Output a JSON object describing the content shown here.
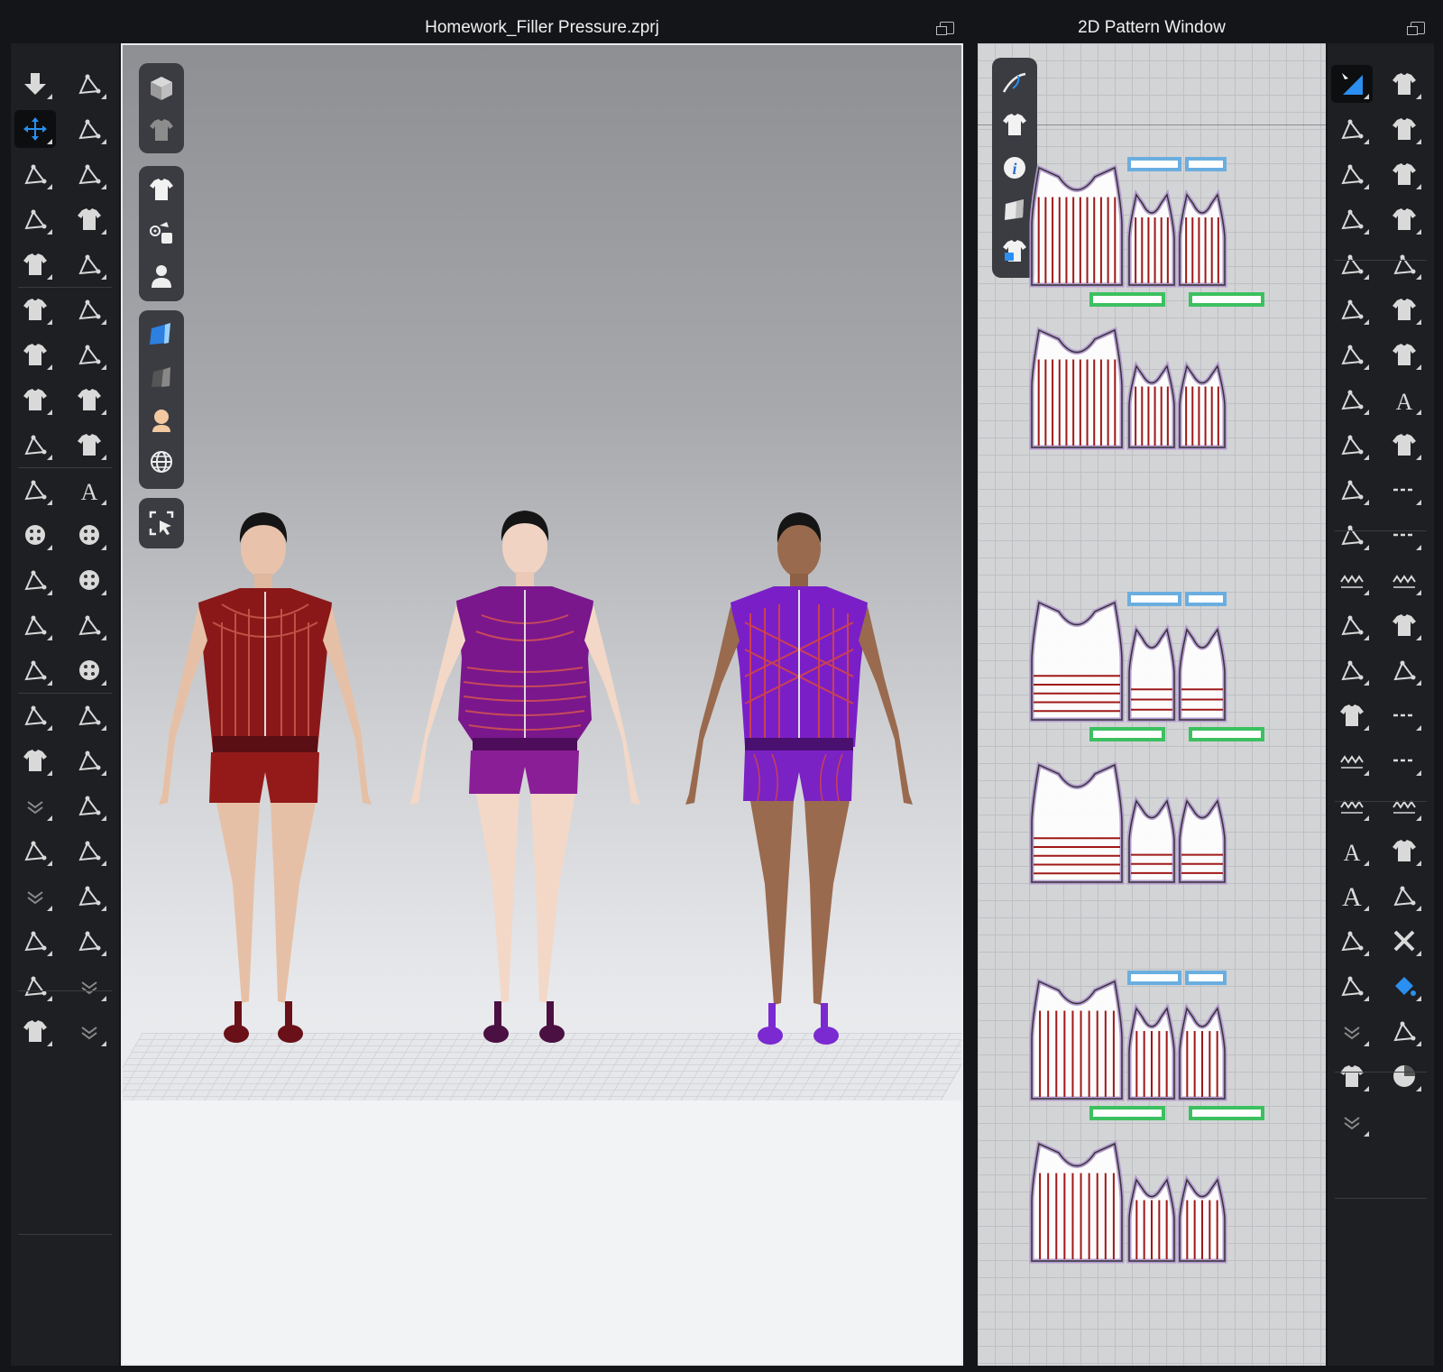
{
  "window_3d": {
    "title": "Homework_Filler Pressure.zprj"
  },
  "window_2d": {
    "title": "2D Pattern Window"
  },
  "colors": {
    "avatar1_garment": "#8a1818",
    "avatar2_garment": "#7a178c",
    "avatar3_garment": "#7a1fc8",
    "selected_tool_accent": "#2a8ff0"
  },
  "left_toolbar_icons": [
    "down-arrow-icon",
    "walk-icon",
    "move-icon",
    "fold-icon",
    "lasso-icon",
    "tack-icon",
    "box-select-icon",
    "garment-pin-icon",
    "garment-icon",
    "sew-icon",
    "garment-fit-icon",
    "seam-icon",
    "garment-move-icon",
    "zip-icon",
    "garment-transform-icon",
    "garment-freeze-icon",
    "sewing-machine-icon",
    "checker-garment-icon",
    "measure-icon",
    "texture-garment-icon",
    "button-icon",
    "button-sew-icon",
    "pin-icon",
    "buttonhole-icon",
    "puppet-icon",
    "strap-icon",
    "avatar-edit-icon",
    "button-lock-icon",
    "fold-arrange-icon",
    "zipper-icon",
    "jacket-icon",
    "zipper-slider-icon",
    "collapse-icon",
    "tube-icon",
    "transform-avatar-icon",
    "cylinder-icon",
    "collapse-icon",
    "box-arrangement-icon",
    "flat-tube-icon",
    "curve-icon",
    "needle-icon",
    "collapse-icon",
    "measure-garment-icon",
    "collapse-icon"
  ],
  "viewport_overlay_icons": [
    "3d-box-icon",
    "garment-display-icon",
    "tshirt-icon",
    "avatar-points-icon",
    "avatar-icon",
    "fabric-blue-icon",
    "fabric-dark-icon",
    "skin-icon",
    "globe-icon",
    "select-area-icon"
  ],
  "pattern_overlay_icons": [
    "needle-thread-icon",
    "tshirt-icon",
    "info-icon",
    "fabric-icon",
    "garment-lock-icon"
  ],
  "right_toolbar_icons": [
    "edit-pattern-icon",
    "garment-attach-icon",
    "polygon-icon",
    "garment-sew-icon",
    "link-icon",
    "garment-free-sew-icon",
    "curve-point-icon",
    "garment-search-icon",
    "bezier-icon",
    "iron-icon",
    "add-point-icon",
    "tshirt-icon",
    "cut-icon",
    "garment-checker-icon",
    "corner-icon",
    "texture-icon",
    "internal-shape-icon",
    "checker-icon",
    "rectangle-icon",
    "dash-line-icon",
    "folder-icon",
    "dotted-line-icon",
    "zigzag-garment-icon",
    "wave-icon",
    "pattern-mirror-icon",
    "garment-stitch-icon",
    "notch-icon",
    "shirring-icon",
    "fold-garment-icon",
    "ruler-vertical-icon",
    "zigzag-icon",
    "ruler-icon",
    "zigzag-icon",
    "garment-zigzag-icon",
    "text-icon",
    "garment-plus-icon",
    "text-large-icon",
    "grid-box-icon",
    "tape-measure-icon",
    "cross-icon",
    "dotted-grid-icon",
    "paint-bucket-icon",
    "collapse-icon",
    "brush-icon",
    "garment-spray-icon",
    "pie-icon",
    "collapse-icon"
  ]
}
